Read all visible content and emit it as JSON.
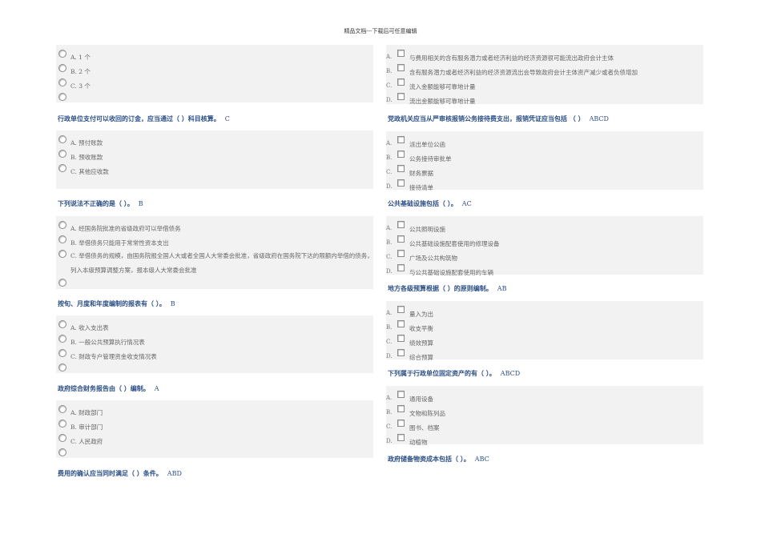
{
  "header": "精品文档---下载后可任意编辑",
  "left": {
    "q0_options": [
      "A. 1 个",
      "B. 2 个",
      "C. 3 个",
      ""
    ],
    "q1": {
      "text": "行政单位支付可以收回的订金，应当通过（  ）科目核算。",
      "answer": "C",
      "options": [
        "A. 预付账款",
        "B. 预收账款",
        "C. 其他应收款"
      ]
    },
    "q2": {
      "text": "下列说法不正确的是（  ）。",
      "answer": "B",
      "options": [
        "A. 经国务院批准的省级政府可以举借债务",
        "B. 举借债务只能用于常常性资本支出",
        "C. 举借债务的规模，由国务院报全国人大或者全国人大常委会批准，省级政府在国务院下达的限额内举借的债务，列入本级预算调整方案，报本级人大常委会批准",
        ""
      ]
    },
    "q3": {
      "text": "按旬、月度和年度编制的报表有（  ）。",
      "answer": "B",
      "options": [
        "A. 收入支出表",
        "B. 一般公共预算执行情况表",
        "C. 财政专户管理资金收支情况表",
        ""
      ]
    },
    "q4": {
      "text": "政府综合财务报告由（  ）编制。",
      "answer": "A",
      "options": [
        "A. 财政部门",
        "B. 审计部门",
        "C. 人民政府",
        ""
      ]
    },
    "q5": {
      "text": "费用的确认应当同时满足（  ）条件。",
      "answer": "ABD"
    }
  },
  "right": {
    "q0_options": [
      {
        "letter": "A.",
        "text": "与费用相关的含有服务潜力或者经济利益的经济资源很可能流出政府会计主体"
      },
      {
        "letter": "B.",
        "text": "含有服务潜力或者经济利益的经济资源流出会导致政府会计主体资产减少或者负债增加"
      },
      {
        "letter": "C.",
        "text": "流入金额能够可靠地计量"
      },
      {
        "letter": "D.",
        "text": "流出金额能够可靠地计量"
      }
    ],
    "q1": {
      "text": "党政机关应当从严审核报销公务接待费支出，报销凭证应当包括  （  ）",
      "answer": "ABCD",
      "options": [
        {
          "letter": "A.",
          "text": "派出单位公函"
        },
        {
          "letter": "B.",
          "text": "公务接待审批单"
        },
        {
          "letter": "C.",
          "text": "财务票据"
        },
        {
          "letter": "D.",
          "text": "接待清单"
        }
      ]
    },
    "q2": {
      "text": "公共基础设施包括（  ）。",
      "answer": "AC",
      "options": [
        {
          "letter": "A.",
          "text": "公共照明设施"
        },
        {
          "letter": "B.",
          "text": "公共基础设施配套使用的修理设备"
        },
        {
          "letter": "C.",
          "text": "广场及公共构筑物"
        },
        {
          "letter": "D.",
          "text": "与公共基础设施配套使用的车辆"
        }
      ]
    },
    "q3": {
      "text": "地方各级预算根据（  ）的原则编制。",
      "answer": "AB",
      "options": [
        {
          "letter": "A.",
          "text": "量入为出"
        },
        {
          "letter": "B.",
          "text": "收支平衡"
        },
        {
          "letter": "C.",
          "text": "绩效预算"
        },
        {
          "letter": "D.",
          "text": "综合预算"
        }
      ]
    },
    "q4": {
      "text": "下列属于行政单位固定资产的有（  ）。",
      "answer": "ABCD",
      "options": [
        {
          "letter": "A.",
          "text": "通用设备"
        },
        {
          "letter": "B.",
          "text": "文物和陈列品"
        },
        {
          "letter": "C.",
          "text": "图书、档案"
        },
        {
          "letter": "D.",
          "text": "动植物"
        }
      ]
    },
    "q5": {
      "text": "政府储备物资成本包括（  ）。",
      "answer": "ABC"
    }
  }
}
